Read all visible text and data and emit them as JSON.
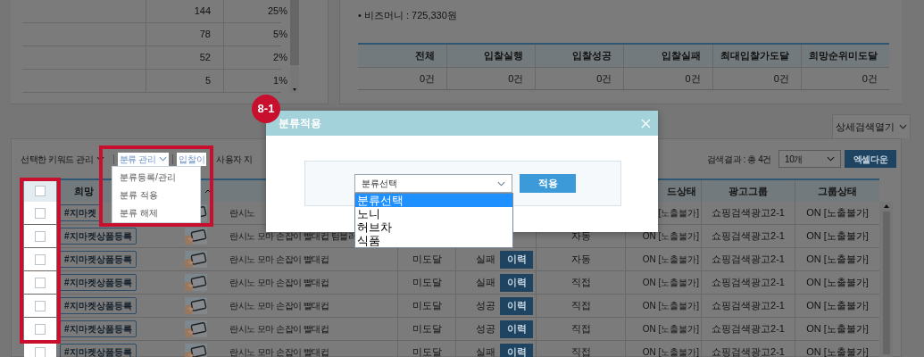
{
  "stats_table": {
    "rows": [
      {
        "count": "144",
        "share": "25%"
      },
      {
        "count": "78",
        "share": "5%"
      },
      {
        "count": "52",
        "share": "2%"
      },
      {
        "count": "5",
        "share": "1%"
      }
    ]
  },
  "account_info": [
    "• 비즈머니 : 725,330원"
  ],
  "summary": {
    "columns": [
      "전체",
      "입찰실행",
      "입찰성공",
      "입찰실패",
      "최대입찰가도달",
      "희망순위미도달"
    ],
    "values": [
      "0건",
      "0건",
      "0건",
      "0건",
      "0건",
      "0건"
    ]
  },
  "detail_search_button": "상세검색열기",
  "toolbar": {
    "items": [
      {
        "kind": "dropdown",
        "label": "선택한 키워드 관리"
      },
      {
        "kind": "menu",
        "label": "분류 관리",
        "open": true,
        "options": [
          "분류등록/관리",
          "분류 적용",
          "분류 해제"
        ]
      },
      {
        "kind": "link",
        "label": "입찰이"
      },
      {
        "kind": "link",
        "label": "사용자 지"
      }
    ],
    "result_count": "검색결과 : 총 4건",
    "page_size": "10개",
    "excel_button": "엑셀다운"
  },
  "table": {
    "header": {
      "checked": false,
      "keyword": "희망",
      "status": "드상태",
      "group": "광고그룹",
      "group_status": "그룹상태"
    },
    "rows": [
      {
        "checked": false,
        "keyword": "#지마켓",
        "name": "란시노",
        "status": "[노출불가]",
        "group": "쇼핑검색광고2-1",
        "group_status": "ON [노출불가]"
      },
      {
        "checked": false,
        "keyword": "#지마켓상품등록",
        "name": "란시노 모마 손잡이 빨대컵 텀블러",
        "mode": "자동",
        "status": "ON [노출불가]",
        "group": "쇼핑검색광고2-1",
        "group_status": "ON [노출불가]"
      },
      {
        "checked": false,
        "keyword": "#지마켓상품등록",
        "name": "란시노 모마 손잡이 빨대컵",
        "rank": "미도달",
        "bid_result": "실패",
        "history": "이력",
        "mode": "자동",
        "status": "ON [노출불가]",
        "group": "쇼핑검색광고2-1",
        "group_status": "ON [노출불가]"
      },
      {
        "checked": false,
        "keyword": "#지마켓상품등록",
        "name": "란시노 모마 손잡이 빨대컵",
        "rank": "미도달",
        "bid_result": "실패",
        "history": "이력",
        "mode": "직접",
        "status": "ON [노출불가]",
        "group": "쇼핑검색광고2-1",
        "group_status": "ON [노출불가]"
      },
      {
        "checked": false,
        "keyword": "#지마켓상품등록",
        "name": "란시노 모마 손잡이 빨대컵",
        "rank": "미도달",
        "bid_result": "성공",
        "history": "이력",
        "mode": "직접",
        "status": "ON [노출불가]",
        "group": "쇼핑검색광고2-1",
        "group_status": "ON [노출불가]"
      },
      {
        "checked": false,
        "keyword": "#지마켓상품등록",
        "name": "란시노 모마 손잡이 빨대컵",
        "rank": "미도달",
        "bid_result": "성공",
        "history": "이력",
        "mode": "직접",
        "status": "ON [노출불가]",
        "group": "쇼핑검색광고2-1",
        "group_status": "ON [노출불가]"
      },
      {
        "checked": false,
        "keyword": "#지마켓상품등록",
        "name": "란시노 모마 손잡이 빨대컵",
        "rank": "미도달",
        "bid_result": "실패",
        "history": "이력",
        "mode": "직접",
        "status": "ON [노출불가]",
        "group": "쇼핑검색광고2-1",
        "group_status": "ON [노출불가]"
      }
    ]
  },
  "dialog": {
    "badge": "8-1",
    "title": "분류적용",
    "select": {
      "value": "분류선택",
      "expanded": true,
      "options": [
        {
          "label": "분류선택",
          "selected": true
        },
        {
          "label": "노니",
          "selected": false
        },
        {
          "label": "허브차",
          "selected": false
        },
        {
          "label": "식품",
          "selected": false
        }
      ]
    },
    "apply_button": "적용"
  }
}
